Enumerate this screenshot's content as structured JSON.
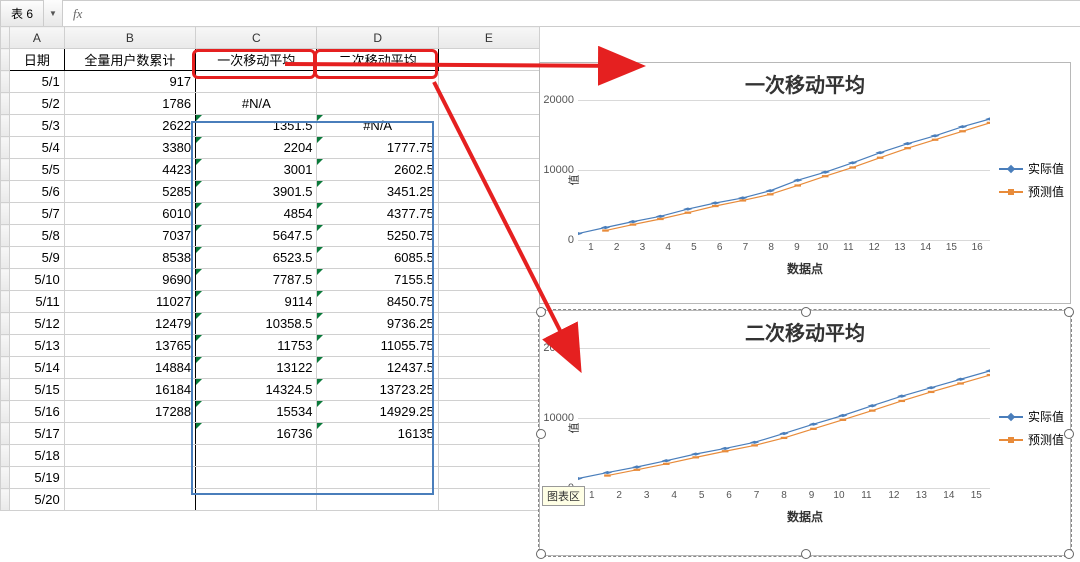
{
  "topbar": {
    "tab_label": "表 6",
    "fx_label": "fx",
    "formula": ""
  },
  "columns": [
    "A",
    "B",
    "C",
    "D",
    "E"
  ],
  "headers": {
    "date": "日期",
    "cum_users": "全量用户数累计",
    "ma1": "一次移动平均",
    "ma2": "二次移动平均"
  },
  "rows": [
    {
      "date": "5/1",
      "cum": "917",
      "ma1": "",
      "ma2": ""
    },
    {
      "date": "5/2",
      "cum": "1786",
      "ma1": "#N/A",
      "ma2": ""
    },
    {
      "date": "5/3",
      "cum": "2622",
      "ma1": "1351.5",
      "ma2": "#N/A"
    },
    {
      "date": "5/4",
      "cum": "3380",
      "ma1": "2204",
      "ma2": "1777.75"
    },
    {
      "date": "5/5",
      "cum": "4423",
      "ma1": "3001",
      "ma2": "2602.5"
    },
    {
      "date": "5/6",
      "cum": "5285",
      "ma1": "3901.5",
      "ma2": "3451.25"
    },
    {
      "date": "5/7",
      "cum": "6010",
      "ma1": "4854",
      "ma2": "4377.75"
    },
    {
      "date": "5/8",
      "cum": "7037",
      "ma1": "5647.5",
      "ma2": "5250.75"
    },
    {
      "date": "5/9",
      "cum": "8538",
      "ma1": "6523.5",
      "ma2": "6085.5"
    },
    {
      "date": "5/10",
      "cum": "9690",
      "ma1": "7787.5",
      "ma2": "7155.5"
    },
    {
      "date": "5/11",
      "cum": "11027",
      "ma1": "9114",
      "ma2": "8450.75"
    },
    {
      "date": "5/12",
      "cum": "12479",
      "ma1": "10358.5",
      "ma2": "9736.25"
    },
    {
      "date": "5/13",
      "cum": "13765",
      "ma1": "11753",
      "ma2": "11055.75"
    },
    {
      "date": "5/14",
      "cum": "14884",
      "ma1": "13122",
      "ma2": "12437.5"
    },
    {
      "date": "5/15",
      "cum": "16184",
      "ma1": "14324.5",
      "ma2": "13723.25"
    },
    {
      "date": "5/16",
      "cum": "17288",
      "ma1": "15534",
      "ma2": "14929.25"
    },
    {
      "date": "5/17",
      "cum": "",
      "ma1": "16736",
      "ma2": "16135"
    },
    {
      "date": "5/18",
      "cum": "",
      "ma1": "",
      "ma2": ""
    },
    {
      "date": "5/19",
      "cum": "",
      "ma1": "",
      "ma2": ""
    },
    {
      "date": "5/20",
      "cum": "",
      "ma1": "",
      "ma2": ""
    }
  ],
  "chart_data": [
    {
      "type": "line",
      "title": "一次移动平均",
      "xlabel": "数据点",
      "ylabel": "值",
      "ylim": [
        0,
        20000
      ],
      "yticks": [
        0,
        10000,
        20000
      ],
      "x": [
        1,
        2,
        3,
        4,
        5,
        6,
        7,
        8,
        9,
        10,
        11,
        12,
        13,
        14,
        15,
        16
      ],
      "series": [
        {
          "name": "实际值",
          "color": "#4a7ebb",
          "marker": "diamond",
          "values": [
            917,
            1786,
            2622,
            3380,
            4423,
            5285,
            6010,
            7037,
            8538,
            9690,
            11027,
            12479,
            13765,
            14884,
            16184,
            17288
          ]
        },
        {
          "name": "预测值",
          "color": "#e88b3a",
          "marker": "square",
          "values": [
            null,
            1351.5,
            2204,
            3001,
            3901.5,
            4854,
            5647.5,
            6523.5,
            7787.5,
            9114,
            10358.5,
            11753,
            13122,
            14324.5,
            15534,
            16736
          ]
        }
      ]
    },
    {
      "type": "line",
      "title": "二次移动平均",
      "xlabel": "数据点",
      "ylabel": "值",
      "ylim": [
        0,
        20000
      ],
      "yticks": [
        0,
        10000,
        20000
      ],
      "x": [
        1,
        2,
        3,
        4,
        5,
        6,
        7,
        8,
        9,
        10,
        11,
        12,
        13,
        14,
        15
      ],
      "tooltip": "图表区",
      "series": [
        {
          "name": "实际值",
          "color": "#4a7ebb",
          "marker": "diamond",
          "values": [
            1351.5,
            2204,
            3001,
            3901.5,
            4854,
            5647.5,
            6523.5,
            7787.5,
            9114,
            10358.5,
            11753,
            13122,
            14324.5,
            15534,
            16736
          ]
        },
        {
          "name": "预测值",
          "color": "#e88b3a",
          "marker": "square",
          "values": [
            null,
            1777.75,
            2602.5,
            3451.25,
            4377.75,
            5250.75,
            6085.5,
            7155.5,
            8450.75,
            9736.25,
            11055.75,
            12437.5,
            13723.25,
            14929.25,
            16135
          ]
        }
      ]
    }
  ],
  "legend_labels": {
    "actual": "实际值",
    "forecast": "预测值"
  },
  "colors": {
    "selection": "#4a7ebb",
    "annotation": "#e52020",
    "series_blue": "#4a7ebb",
    "series_orange": "#e88b3a"
  }
}
